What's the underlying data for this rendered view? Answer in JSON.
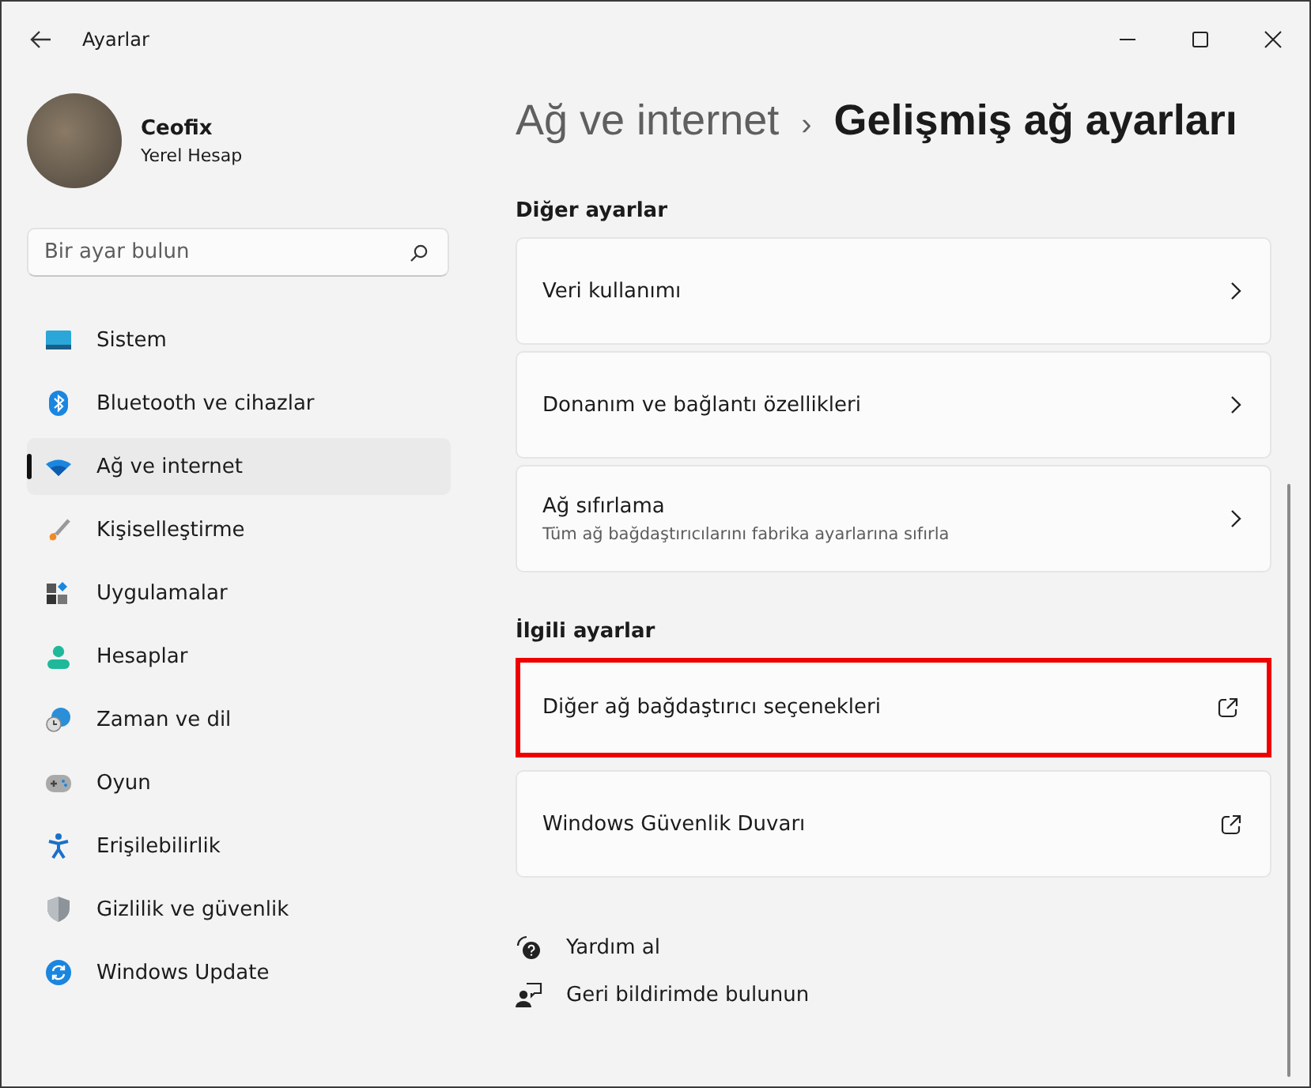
{
  "window": {
    "title": "Ayarlar"
  },
  "profile": {
    "name": "Ceofix",
    "account": "Yerel Hesap"
  },
  "search": {
    "placeholder": "Bir ayar bulun"
  },
  "sidebar": {
    "items": [
      {
        "label": "Sistem",
        "selected": false
      },
      {
        "label": "Bluetooth ve cihazlar",
        "selected": false
      },
      {
        "label": "Ağ ve internet",
        "selected": true
      },
      {
        "label": "Kişiselleştirme",
        "selected": false
      },
      {
        "label": "Uygulamalar",
        "selected": false
      },
      {
        "label": "Hesaplar",
        "selected": false
      },
      {
        "label": "Zaman ve dil",
        "selected": false
      },
      {
        "label": "Oyun",
        "selected": false
      },
      {
        "label": "Erişilebilirlik",
        "selected": false
      },
      {
        "label": "Gizlilik ve güvenlik",
        "selected": false
      },
      {
        "label": "Windows Update",
        "selected": false
      }
    ]
  },
  "breadcrumb": {
    "parent": "Ağ ve internet",
    "separator": "›",
    "current": "Gelişmiş ağ ayarları"
  },
  "sections": [
    {
      "title": "Diğer ayarlar",
      "cards": [
        {
          "kind": "nav",
          "label": "Veri kullanımı",
          "highlighted": false
        },
        {
          "kind": "nav",
          "label": "Donanım ve bağlantı özellikleri",
          "highlighted": false
        },
        {
          "kind": "nav",
          "label": "Ağ sıfırlama",
          "description": "Tüm ağ bağdaştırıcılarını fabrika ayarlarına sıfırla",
          "highlighted": false
        }
      ]
    },
    {
      "title": "İlgili ayarlar",
      "cards": [
        {
          "kind": "external",
          "label": "Diğer ağ bağdaştırıcı seçenekleri",
          "highlighted": true
        },
        {
          "kind": "external",
          "label": "Windows Güvenlik Duvarı",
          "highlighted": false
        }
      ]
    }
  ],
  "footer_links": [
    "Yardım al",
    "Geri bildirimde bulunun"
  ]
}
